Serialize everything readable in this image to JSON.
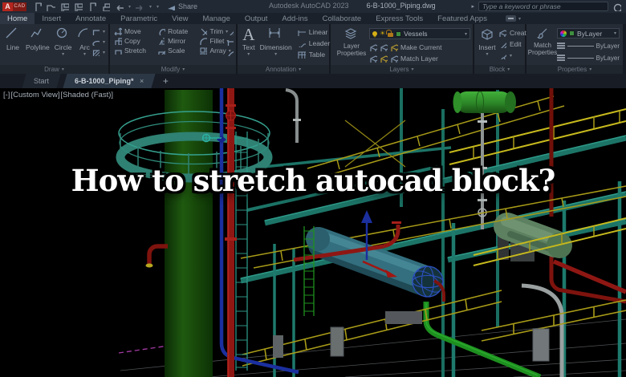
{
  "window": {
    "logo_a": "A",
    "logo_cad": "CAD",
    "share_label": "Share",
    "app_title": "Autodesk AutoCAD 2023",
    "doc_title": "6-B-1000_Piping.dwg",
    "search_placeholder": "Type a keyword or phrase"
  },
  "ribbon": {
    "tabs": [
      {
        "label": "Home",
        "active": true
      },
      {
        "label": "Insert"
      },
      {
        "label": "Annotate"
      },
      {
        "label": "Parametric"
      },
      {
        "label": "View"
      },
      {
        "label": "Manage"
      },
      {
        "label": "Output"
      },
      {
        "label": "Add-ins"
      },
      {
        "label": "Collaborate"
      },
      {
        "label": "Express Tools"
      },
      {
        "label": "Featured Apps"
      }
    ],
    "panels": {
      "draw": {
        "label": "Draw",
        "tools": [
          {
            "label": "Line"
          },
          {
            "label": "Polyline"
          },
          {
            "label": "Circle"
          },
          {
            "label": "Arc"
          }
        ]
      },
      "modify": {
        "label": "Modify",
        "tools": [
          {
            "label": "Move"
          },
          {
            "label": "Rotate"
          },
          {
            "label": "Trim"
          },
          {
            "label": "Copy"
          },
          {
            "label": "Mirror"
          },
          {
            "label": "Fillet"
          },
          {
            "label": "Stretch"
          },
          {
            "label": "Scale"
          },
          {
            "label": "Array"
          }
        ]
      },
      "annotation": {
        "label": "Annotation",
        "text": "Text",
        "dimension": "Dimension",
        "linear": "Linear",
        "leader": "Leader",
        "table": "Table"
      },
      "layers": {
        "label": "Layers",
        "layer_properties": "Layer Properties",
        "current_layer": "Vessels",
        "make_current": "Make Current",
        "match_layer": "Match Layer"
      },
      "block": {
        "label": "Block",
        "insert": "Insert",
        "create": "Create",
        "edit": "Edit"
      },
      "properties": {
        "label": "Properties",
        "match_properties": "Match Properties",
        "color": "ByLayer",
        "lineweight": "ByLayer",
        "linetype": "ByLayer"
      }
    }
  },
  "file_tabs": {
    "start": "Start",
    "active": "6-B-1000_Piping*",
    "close": "×",
    "new_tab": "+"
  },
  "viewport": {
    "viewport_menu": "[-]",
    "view_menu": "[Custom View]",
    "style_menu": "[Shaded (Fast)]"
  },
  "overlay": {
    "headline": "How to stretch autocad block?"
  },
  "colors": {
    "column_green": "#1e5410",
    "structure_teal": "#1c7467",
    "rail_yellow": "#a89b18",
    "pipe_red": "#8e1713",
    "vessel_green": "#2f8f29",
    "vessel_teal": "#336f7e",
    "vessel_sage": "#5d8160",
    "pipe_blue": "#1b2f9e",
    "pipe_gray": "#8e9494",
    "annotation_magenta": "#a23aa2",
    "headline_color": "#ffffff"
  }
}
